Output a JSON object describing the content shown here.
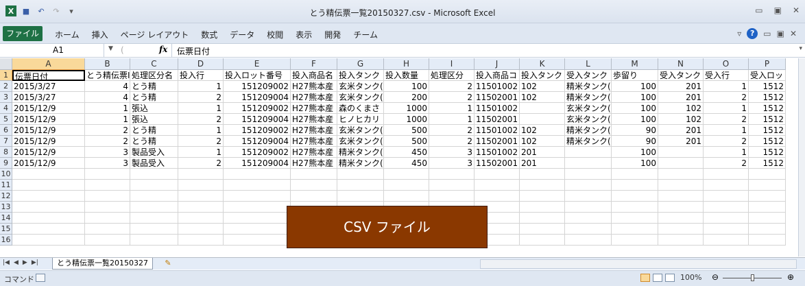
{
  "window": {
    "title": "とう精伝票一覧20150327.csv - Microsoft Excel",
    "controls": [
      "▭",
      "▣",
      "✕"
    ]
  },
  "quick_access": {
    "excel_icon": "excel-logo-icon",
    "save": "save-icon",
    "undo": "undo-icon",
    "redo": "redo-icon"
  },
  "ribbon": {
    "file_label": "ファイル",
    "tabs": [
      "ホーム",
      "挿入",
      "ページ レイアウト",
      "数式",
      "データ",
      "校閲",
      "表示",
      "開発",
      "チーム"
    ]
  },
  "formula_bar": {
    "name_box": "A1",
    "fx_label": "fx",
    "content": "伝票日付"
  },
  "columns": [
    "A",
    "B",
    "C",
    "D",
    "E",
    "F",
    "G",
    "H",
    "I",
    "J",
    "K",
    "L",
    "M",
    "N",
    "O",
    "P"
  ],
  "rows": [
    [
      "伝票日付",
      "とう精伝票Ⅰ",
      "処理区分名",
      "投入行",
      "投入ロット番号",
      "投入商品名",
      "投入タンク",
      "投入数量",
      "処理区分",
      "投入商品コ",
      "投入タンク",
      "受入タンク",
      "歩留り",
      "受入タンク",
      "受入行",
      "受入ロット"
    ],
    [
      "2015/3/27",
      "4",
      "とう精",
      "1",
      "151209002",
      "H27熊本産",
      "玄米タンク(",
      "100",
      "2",
      "11501002",
      "102",
      "精米タンク(",
      "100",
      "201",
      "1",
      "1512"
    ],
    [
      "2015/3/27",
      "4",
      "とう精",
      "2",
      "151209004",
      "H27熊本産",
      "玄米タンク(",
      "200",
      "2",
      "11502001",
      "102",
      "精米タンク(",
      "100",
      "201",
      "2",
      "1512"
    ],
    [
      "2015/12/9",
      "1",
      "張込",
      "1",
      "151209002",
      "H27熊本産",
      "森のくまさ",
      "1000",
      "1",
      "11501002",
      "",
      "玄米タンク(",
      "100",
      "102",
      "1",
      "1512"
    ],
    [
      "2015/12/9",
      "1",
      "張込",
      "2",
      "151209004",
      "H27熊本産",
      "ヒノヒカリ 1",
      "1000",
      "1",
      "11502001",
      "",
      "玄米タンク(",
      "100",
      "102",
      "2",
      "1512"
    ],
    [
      "2015/12/9",
      "2",
      "とう精",
      "1",
      "151209002",
      "H27熊本産",
      "玄米タンク(",
      "500",
      "2",
      "11501002",
      "102",
      "精米タンク(",
      "90",
      "201",
      "1",
      "1512"
    ],
    [
      "2015/12/9",
      "2",
      "とう精",
      "2",
      "151209004",
      "H27熊本産",
      "玄米タンク(",
      "500",
      "2",
      "11502001",
      "102",
      "精米タンク(",
      "90",
      "201",
      "2",
      "1512"
    ],
    [
      "2015/12/9",
      "3",
      "製品受入",
      "1",
      "151209002",
      "H27熊本産",
      "精米タンク(",
      "450",
      "3",
      "11501002",
      "201",
      "",
      "100",
      "",
      "1",
      "1512"
    ],
    [
      "2015/12/9",
      "3",
      "製品受入",
      "2",
      "151209004",
      "H27熊本産",
      "精米タンク(",
      "450",
      "3",
      "11502001",
      "201",
      "",
      "100",
      "",
      "2",
      "1512"
    ],
    [
      "",
      "",
      "",
      "",
      "",
      "",
      "",
      "",
      "",
      "",
      "",
      "",
      "",
      "",
      "",
      ""
    ],
    [
      "",
      "",
      "",
      "",
      "",
      "",
      "",
      "",
      "",
      "",
      "",
      "",
      "",
      "",
      "",
      ""
    ],
    [
      "",
      "",
      "",
      "",
      "",
      "",
      "",
      "",
      "",
      "",
      "",
      "",
      "",
      "",
      "",
      ""
    ],
    [
      "",
      "",
      "",
      "",
      "",
      "",
      "",
      "",
      "",
      "",
      "",
      "",
      "",
      "",
      "",
      ""
    ],
    [
      "",
      "",
      "",
      "",
      "",
      "",
      "",
      "",
      "",
      "",
      "",
      "",
      "",
      "",
      "",
      ""
    ],
    [
      "",
      "",
      "",
      "",
      "",
      "",
      "",
      "",
      "",
      "",
      "",
      "",
      "",
      "",
      "",
      ""
    ],
    [
      "",
      "",
      "",
      "",
      "",
      "",
      "",
      "",
      "",
      "",
      "",
      "",
      "",
      "",
      "",
      ""
    ]
  ],
  "numeric_columns": [
    1,
    3,
    4,
    7,
    8,
    12,
    13,
    14,
    15
  ],
  "overlay_label": "CSV ファイル",
  "sheet_tab": "とう精伝票一覧20150327",
  "status": {
    "mode": "コマンド",
    "zoom": "100%"
  },
  "colors": {
    "overlay_bg": "#8a3800",
    "file_tab": "#1e7145",
    "selection": "#f9d99a"
  }
}
